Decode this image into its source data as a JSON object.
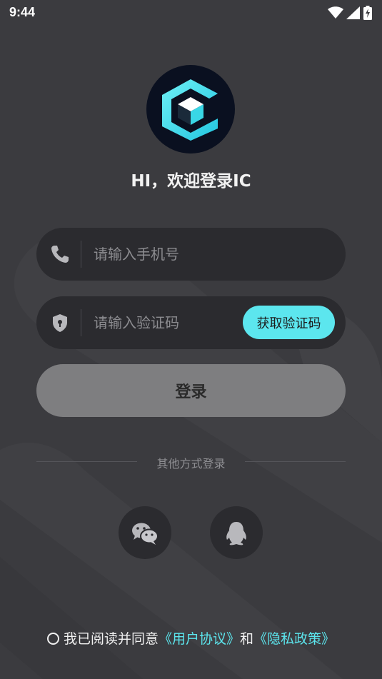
{
  "status_bar": {
    "time": "9:44",
    "icons": [
      "wifi-icon",
      "signal-icon",
      "battery-charging-icon"
    ]
  },
  "app": {
    "logo": "ic-logo",
    "welcome": "HI，欢迎登录IC"
  },
  "phone_field": {
    "icon": "phone-icon",
    "placeholder": "请输入手机号",
    "value": ""
  },
  "code_field": {
    "icon": "shield-icon",
    "placeholder": "请输入验证码",
    "value": "",
    "get_code_label": "获取验证码"
  },
  "login_button": {
    "label": "登录"
  },
  "other_login": {
    "label": "其他方式登录",
    "options": [
      {
        "name": "wechat",
        "icon": "wechat-icon"
      },
      {
        "name": "qq",
        "icon": "qq-icon"
      }
    ]
  },
  "agreement": {
    "prefix": "我已阅读并同意",
    "user_agreement": "《用户协议》",
    "conjunction": "和",
    "privacy_policy": "《隐私政策》"
  },
  "colors": {
    "background": "#3b3b3f",
    "field_background": "#2b2b2f",
    "accent": "#5ce6ee",
    "login_button_disabled": "#7e7e80",
    "logo_background": "#0a1020"
  }
}
